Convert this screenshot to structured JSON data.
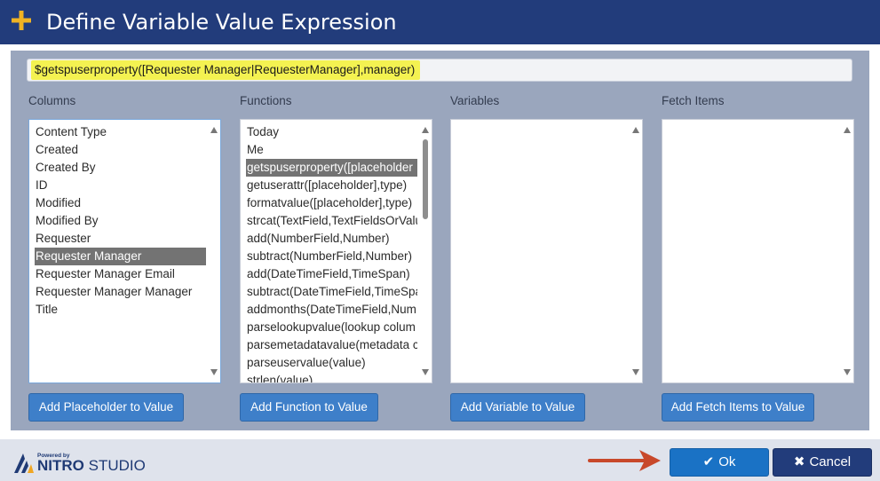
{
  "dialog": {
    "title": "Define Variable Value Expression",
    "expression": "$getspuserproperty([Requester Manager|RequesterManager],manager)"
  },
  "columns": {
    "label": "Columns",
    "items": [
      "Content Type",
      "Created",
      "Created By",
      "ID",
      "Modified",
      "Modified By",
      "Requester",
      "Requester Manager",
      "Requester Manager Email",
      "Requester Manager Manager",
      "Title"
    ],
    "selected": "Requester Manager",
    "button": "Add Placeholder to Value"
  },
  "functions": {
    "label": "Functions",
    "items": [
      "Today",
      "Me",
      "getspuserproperty([placeholder",
      "getuserattr([placeholder],type)",
      "formatvalue([placeholder],type)",
      "strcat(TextField,TextFieldsOrValu",
      "add(NumberField,Number)",
      "subtract(NumberField,Number)",
      "add(DateTimeField,TimeSpan)",
      "subtract(DateTimeField,TimeSpa",
      "addmonths(DateTimeField,Num",
      "parselookupvalue(lookup colum",
      "parsemetadatavalue(metadata c",
      "parseuservalue(value)",
      "strlen(value)"
    ],
    "selected": "getspuserproperty([placeholder",
    "button": "Add Function to Value"
  },
  "variables": {
    "label": "Variables",
    "items": [],
    "button": "Add Variable to Value"
  },
  "fetch_items": {
    "label": "Fetch Items",
    "items": [],
    "button": "Add Fetch Items to Value"
  },
  "footer": {
    "powered_by": "Powered by",
    "brand": "NITRO",
    "brand_suffix": "STUDIO",
    "ok_label": "Ok",
    "cancel_label": "Cancel"
  },
  "colors": {
    "titlebar": "#223c7b",
    "accent_plus": "#f0b323",
    "button_blue": "#3e7fc9",
    "highlight": "#f4f251",
    "arrow": "#c8482a"
  }
}
